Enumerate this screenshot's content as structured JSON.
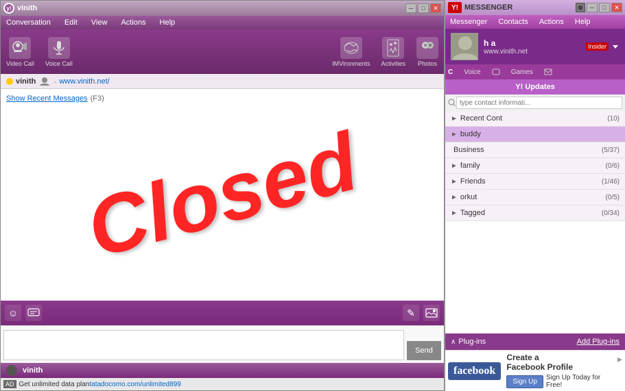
{
  "chat_window": {
    "title": "vinith",
    "title_icon": "v",
    "menu": {
      "items": [
        "Conversation",
        "Edit",
        "View",
        "Actions",
        "Help"
      ]
    },
    "toolbar": {
      "buttons": [
        {
          "id": "video-call",
          "label": "Video Call",
          "icon": "📹"
        },
        {
          "id": "voice-call",
          "label": "Voice Call",
          "icon": "🎤"
        },
        {
          "id": "imvironments",
          "label": "IMVironments",
          "icon": "🎭"
        },
        {
          "id": "activities",
          "label": "Activities",
          "icon": "♟"
        },
        {
          "id": "photos",
          "label": "Photos",
          "icon": "👤"
        }
      ]
    },
    "status": {
      "name": "vinith",
      "dot_color": "#ffcc00",
      "separator": "-",
      "link_text": "www.vinith.net/",
      "link_url": "http://www.vinith.net/"
    },
    "chat_area": {
      "show_recent_label": "Show Recent Messages",
      "show_recent_shortcut": "(F3)",
      "watermark": "Closed"
    },
    "chat_tools": [
      {
        "id": "smiley",
        "icon": "☺"
      },
      {
        "id": "buzz",
        "icon": "💬"
      },
      {
        "id": "format",
        "icon": "✎"
      },
      {
        "id": "image",
        "icon": "🖼"
      }
    ],
    "input": {
      "placeholder": "",
      "send_label": "Send"
    },
    "bottom_status": {
      "name": "vinith"
    },
    "ad_bar": {
      "ad_label": "AD",
      "text": "Get unlimited data plan",
      "link_text": "tatadocomo.com/unlimited899",
      "link_url": "#"
    }
  },
  "messenger_panel": {
    "title": "MESSENGER",
    "menu": {
      "items": [
        "Messenger",
        "Contacts",
        "Actions",
        "Help"
      ]
    },
    "profile": {
      "name": "h a",
      "status_link": "www.vinith.net",
      "insider_label": "Insider",
      "sub_tabs": [
        "Voice",
        "Games"
      ]
    },
    "updates_panel": {
      "title": "Y! Updates"
    },
    "search": {
      "placeholder": "type contact informati..."
    },
    "contact_groups": [
      {
        "id": "recent-contacts",
        "name": "Recent Cont",
        "count": "(10)",
        "highlighted": false,
        "arrow": "►"
      },
      {
        "id": "buddy",
        "name": "buddy",
        "count": "",
        "highlighted": true,
        "arrow": "►"
      },
      {
        "id": "business",
        "name": "Business",
        "count": "(5/37)",
        "highlighted": false,
        "arrow": ""
      },
      {
        "id": "family",
        "name": "family",
        "count": "(0/6)",
        "highlighted": false,
        "arrow": "►"
      },
      {
        "id": "friends",
        "name": "Friends",
        "count": "(1/46)",
        "highlighted": false,
        "arrow": "►"
      },
      {
        "id": "orkut",
        "name": "orkut",
        "count": "(0/5)",
        "highlighted": false,
        "arrow": "►"
      },
      {
        "id": "tagged",
        "name": "Tagged",
        "count": "(0/34)",
        "highlighted": false,
        "arrow": "►"
      }
    ],
    "plugins": {
      "label": "Plug-ins",
      "add_label": "Add Plug-ins"
    },
    "fb_ad": {
      "logo": "facebook",
      "title": "Create a",
      "title2": "Facebook Profile",
      "signup_label": "Sign Up",
      "sub_text": "Sign Up Today for Free!"
    }
  },
  "title_controls": {
    "minimize": "─",
    "maximize": "□",
    "close": "✕"
  }
}
